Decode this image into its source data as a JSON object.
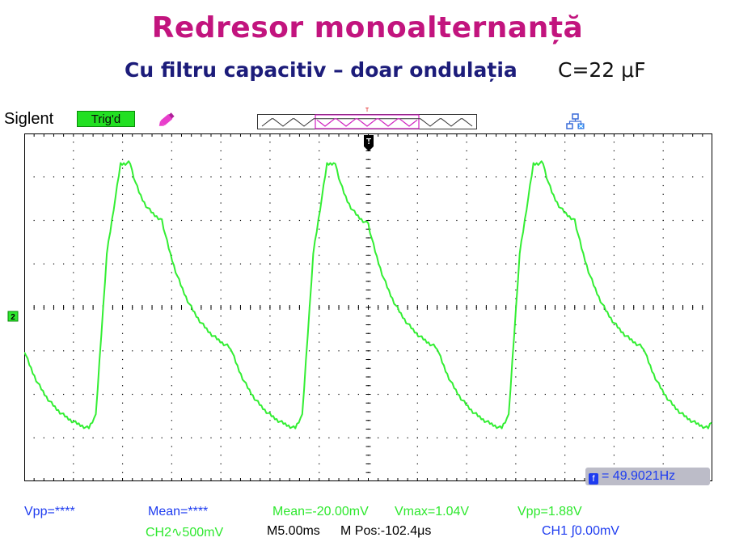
{
  "slide": {
    "title": "Redresor monoalternanță",
    "subtitle": "Cu filtru capacitiv – doar ondulația",
    "capacitance": "C=22 μF"
  },
  "scope": {
    "brand": "Siglent",
    "trigger_status": "Trig'd",
    "frequency": "= 49.9021Hz",
    "status_row1": {
      "vpp_ch1": "Vpp=****",
      "mean_ch1": "Mean=****",
      "mean_ch2": "Mean=-20.00mV",
      "vmax_ch2": "Vmax=1.04V",
      "vpp_ch2": "Vpp=1.88V"
    },
    "status_row2": {
      "ch2_scale": "CH2∿500mV",
      "timebase": "M5.00ms",
      "mpos": "M Pos:-102.4μs",
      "ch1_trigger": "CH1 ∫0.00mV"
    },
    "icons": [
      "pen-icon",
      "trigger-marker-icon",
      "network-icon",
      "channel-marker-icon"
    ],
    "colors": {
      "trace": "#33ee33",
      "grid": "#000000",
      "trig_bg": "#22e022"
    }
  },
  "chart_data": {
    "type": "line",
    "title": "",
    "xlabel": "",
    "ylabel": "",
    "x_unit_per_div": "5.00ms",
    "y_unit_per_div": "500mV",
    "xlim": [
      -25,
      25
    ],
    "ylim": [
      -1.25,
      1.25
    ],
    "grid": true,
    "series": [
      {
        "channel": "CH2",
        "points": [
          [
            -25.0,
            -0.31
          ],
          [
            -20.3,
            -0.87
          ],
          [
            -19.8,
            -0.78
          ],
          [
            -19.0,
            0.39
          ],
          [
            -18.0,
            1.03
          ],
          [
            -17.3,
            1.04
          ],
          [
            -15.0,
            0.63
          ],
          [
            -10.0,
            -0.29
          ],
          [
            -5.3,
            -0.87
          ],
          [
            -4.8,
            -0.78
          ],
          [
            -4.0,
            0.39
          ],
          [
            -3.0,
            1.03
          ],
          [
            -2.4,
            1.04
          ],
          [
            0.0,
            0.6
          ],
          [
            5.0,
            -0.29
          ],
          [
            9.7,
            -0.87
          ],
          [
            10.2,
            -0.78
          ],
          [
            11.0,
            0.39
          ],
          [
            12.0,
            1.03
          ],
          [
            12.7,
            1.04
          ],
          [
            15.0,
            0.63
          ],
          [
            20.0,
            -0.29
          ],
          [
            24.7,
            -0.87
          ],
          [
            25.2,
            -0.78
          ]
        ]
      }
    ]
  }
}
